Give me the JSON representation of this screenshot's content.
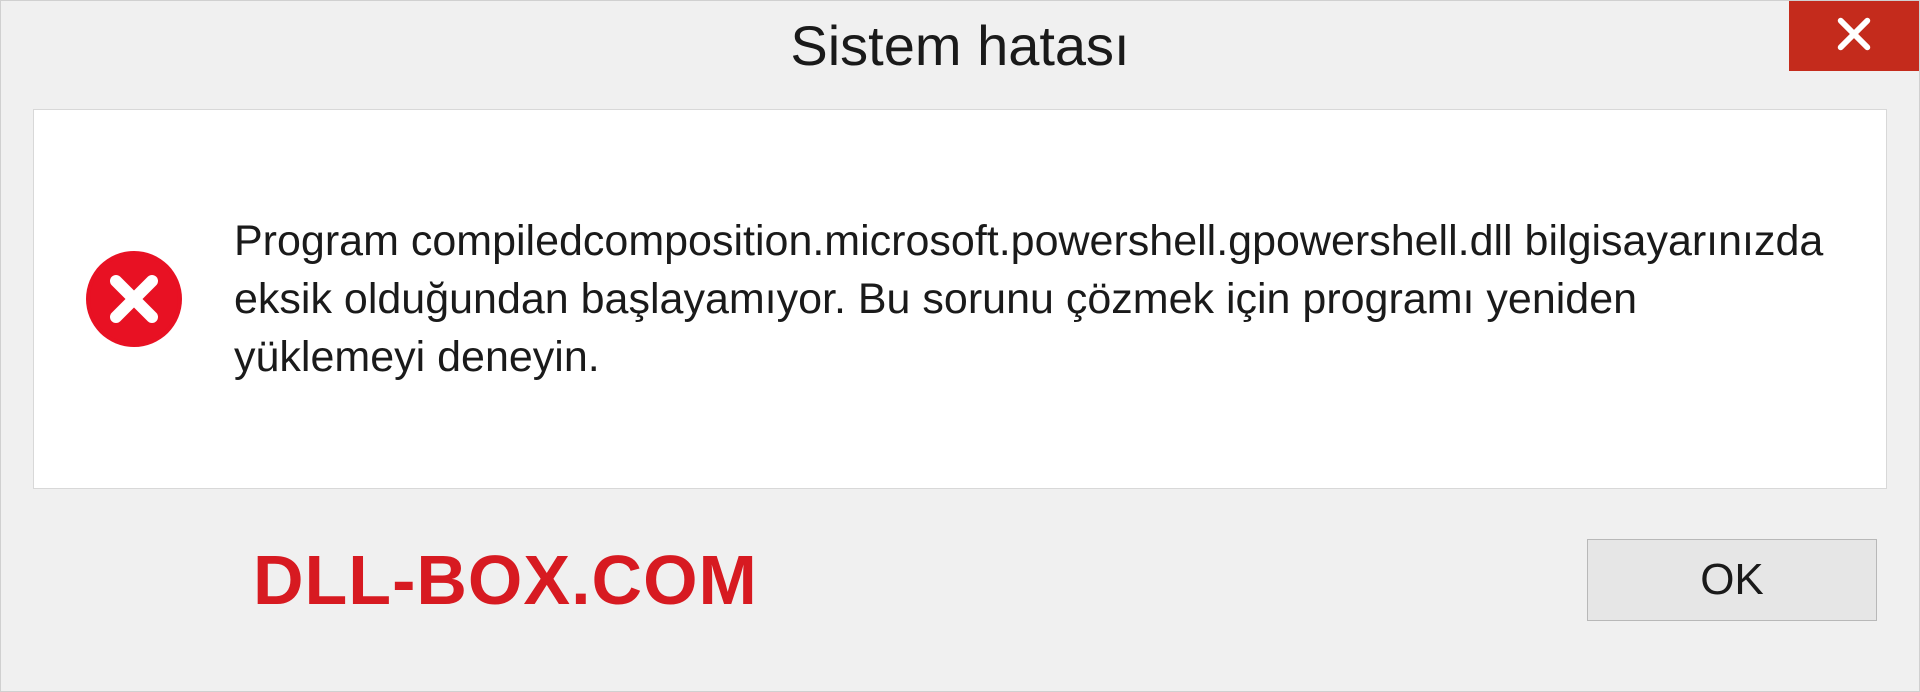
{
  "dialog": {
    "title": "Sistem hatası",
    "message": "Program compiledcomposition.microsoft.powershell.gpowershell.dll bilgisayarınızda eksik olduğundan başlayamıyor. Bu sorunu çözmek için programı yeniden yüklemeyi deneyin.",
    "ok_label": "OK"
  },
  "watermark": "DLL-BOX.COM",
  "colors": {
    "close_bg": "#c42b1c",
    "error_icon": "#e81123",
    "watermark": "#d71a21"
  }
}
